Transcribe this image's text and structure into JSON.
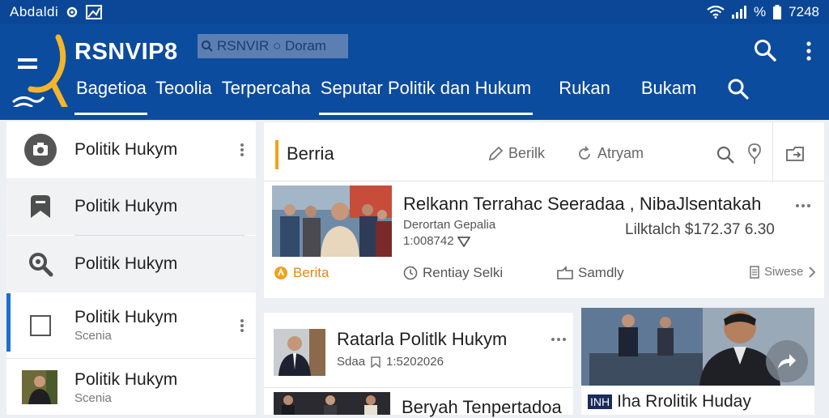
{
  "status_bar": {
    "left_text": "Abdaldi",
    "time": "7248",
    "battery_text": "%"
  },
  "header": {
    "app_title": "RSNVIP8",
    "search_chip": "RSNVIR ○ Doram",
    "tabs": [
      {
        "label": "Bagetioa"
      },
      {
        "label": "Teoolia"
      },
      {
        "label": "Terpercaha"
      },
      {
        "label": "Seputar Politik dan Hukum"
      },
      {
        "label": "Rukan"
      },
      {
        "label": "Bukam"
      }
    ]
  },
  "sidebar": {
    "items": [
      {
        "label": "Politik Hukym",
        "icon": "camera-icon"
      },
      {
        "label": "Politik Hukym",
        "icon": "bookmark-icon"
      },
      {
        "label": "Politik Hukym",
        "icon": "search-icon"
      },
      {
        "label": "Politik Hukym",
        "sub": "Scenia",
        "icon": "checkbox-icon"
      },
      {
        "label": "Politik Hukym",
        "sub": "Scenia",
        "icon": "avatar-thumbnail"
      }
    ]
  },
  "main_card": {
    "section_title": "Berria",
    "actions": {
      "edit": "Berilk",
      "share": "Atryam"
    },
    "headline": "Relkann Terrahac Seeradaa , NibaJlsentakah",
    "meta_line1": "Derortan Gepalia",
    "meta_line2": "1:008742",
    "right_value": "Lilktalch $172.37 6.30",
    "footer": {
      "category": "Berita",
      "time_label": "Rentiay Selki",
      "share_label": "Samdly",
      "more_label": "Siwese"
    }
  },
  "small_card": {
    "title": "Ratarla Politlk Hukym",
    "meta_source": "Sdaa",
    "meta_date": "1:5202026",
    "second_title": "Beryah Tenpertadoa"
  },
  "image_card": {
    "caption_prefix": "INH",
    "caption": "Iha Rrolitik Huday"
  },
  "colors": {
    "primary": "#0c4c9e",
    "accent": "#f0a21b",
    "sidebar_active": "#1a6fcf"
  }
}
